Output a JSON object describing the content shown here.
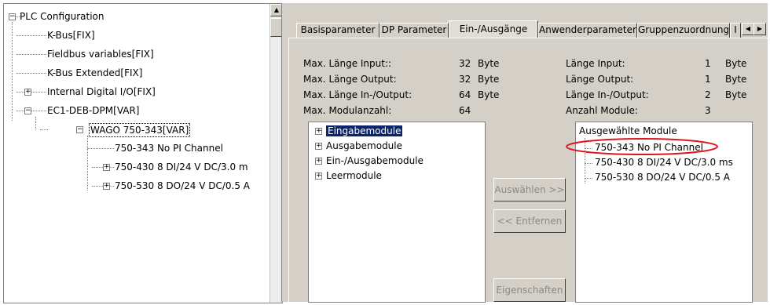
{
  "tree": {
    "root": "PLC Configuration",
    "items": [
      "K-Bus[FIX]",
      "Fieldbus variables[FIX]",
      "K-Bus Extended[FIX]",
      "Internal Digital I/O[FIX]",
      "EC1-DEB-DPM[VAR]",
      "WAGO 750-343[VAR]",
      "750-343 No PI Channel",
      "750-430  8 DI/24 V DC/3.0 m",
      "750-530  8 DO/24 V DC/0.5 A"
    ]
  },
  "tabs": [
    "Basisparameter",
    "DP Parameter",
    "Ein-/Ausgänge",
    "Anwenderparameter",
    "Gruppenzuordnung",
    "I"
  ],
  "info_left": [
    {
      "label": "Max. Länge Input::",
      "value": "32",
      "unit": "Byte"
    },
    {
      "label": "Max. Länge Output:",
      "value": "32",
      "unit": "Byte"
    },
    {
      "label": "Max. Länge In-/Output:",
      "value": "64",
      "unit": "Byte"
    },
    {
      "label": "Max. Modulanzahl:",
      "value": "64",
      "unit": ""
    }
  ],
  "info_right": [
    {
      "label": "Länge Input:",
      "value": "1",
      "unit": "Byte"
    },
    {
      "label": "Länge Output:",
      "value": "1",
      "unit": "Byte"
    },
    {
      "label": "Länge In-/Output:",
      "value": "2",
      "unit": "Byte"
    },
    {
      "label": "Anzahl Module:",
      "value": "3",
      "unit": ""
    }
  ],
  "available_modules": [
    "Eingabemodule",
    "Ausgabemodule",
    "Ein-/Ausgabemodule",
    "Leermodule"
  ],
  "buttons": {
    "select": "Auswählen >>",
    "remove": "<< Entfernen",
    "properties": "Eigenschaften"
  },
  "selected_modules": {
    "header": "Ausgewählte Module",
    "items": [
      "750-343 No PI Channel",
      "750-430  8 DI/24 V DC/3.0 ms",
      "750-530  8 DO/24 V DC/0.5 A"
    ]
  },
  "colors": {
    "highlight_circle": "#e0141e",
    "selection": "#0a246a"
  }
}
